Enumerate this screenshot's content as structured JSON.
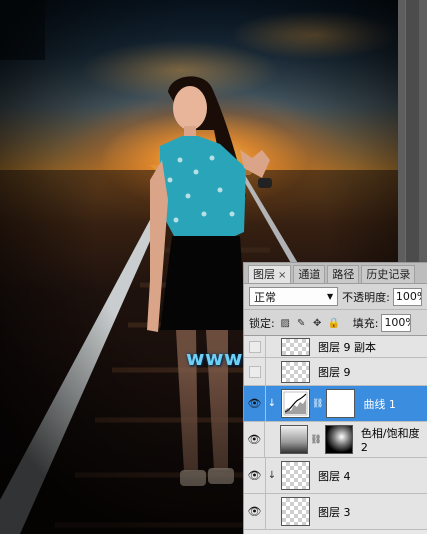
{
  "watermark": "www.68ps.com",
  "panel": {
    "tabs": [
      {
        "label": "图层",
        "close": "×"
      },
      {
        "label": "通道"
      },
      {
        "label": "路径"
      },
      {
        "label": "历史记录"
      }
    ],
    "blend_mode": "正常",
    "opacity_label": "不透明度:",
    "opacity_value": "100%",
    "lock_label": "锁定:",
    "fill_label": "填充:",
    "fill_value": "100%",
    "layers": [
      {
        "name": "图层 9 副本",
        "visible": false,
        "thumb": "transparent"
      },
      {
        "name": "图层 9",
        "visible": false,
        "thumb": "transparent"
      },
      {
        "name": "曲线 1",
        "visible": true,
        "selected": true,
        "thumb": "curves",
        "mask": "white",
        "clipped": true
      },
      {
        "name": "色相/饱和度 2",
        "visible": true,
        "thumb": "hue-saturation",
        "mask": "dark"
      },
      {
        "name": "图层 4",
        "visible": true,
        "thumb": "transparent",
        "clipped": true
      },
      {
        "name": "图层 3",
        "visible": true,
        "thumb": "transparent"
      }
    ]
  },
  "colors": {
    "selection": "#3b8de0",
    "watermark": "#6fd0f5"
  }
}
